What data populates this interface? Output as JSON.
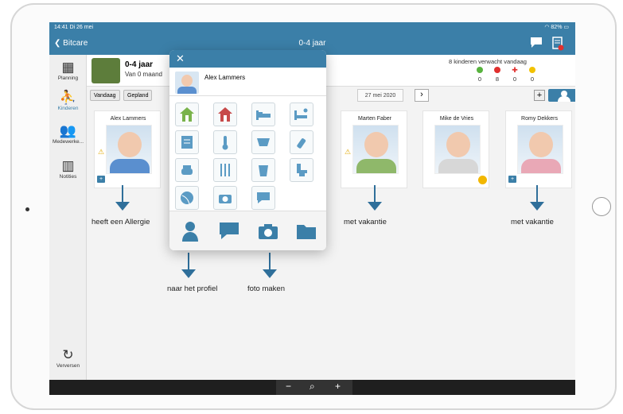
{
  "status": {
    "time": "14:41",
    "date": "Di 26 mei",
    "battery": "82%"
  },
  "nav": {
    "back_label": "Bitcare",
    "title": "0-4 jaar"
  },
  "sidebar": {
    "items": [
      {
        "label": "Planning",
        "icon": "calendar-icon"
      },
      {
        "label": "Kinderen",
        "icon": "children-icon"
      },
      {
        "label": "Medewerke...",
        "icon": "staff-icon"
      },
      {
        "label": "Notities",
        "icon": "notes-icon"
      },
      {
        "label": "Verversen",
        "icon": "refresh-icon"
      }
    ]
  },
  "group": {
    "title": "0-4 jaar",
    "subtitle": "Van 0 maand",
    "expected_text": "8 kinderen verwacht vandaag",
    "counts": [
      {
        "color": "#58b33e",
        "value": "0"
      },
      {
        "color": "#e0302e",
        "value": "8"
      },
      {
        "color": "#e0302e",
        "value": "0"
      },
      {
        "color": "#f2c200",
        "value": "0"
      }
    ]
  },
  "filters": {
    "today": "Vandaag",
    "planned": "Gepland",
    "date": "27 mei 2020",
    "next": "›",
    "add": "+"
  },
  "children": [
    {
      "name": "Alex Lammers",
      "icon": "allergy-warning-icon"
    },
    {
      "name": "Marten Faber",
      "icon": "allergy-warning-icon"
    },
    {
      "name": "Mike de Vries",
      "icon": "vacation-icon"
    },
    {
      "name": "Romy Dekkers",
      "icon": "medical-icon"
    }
  ],
  "popup": {
    "child_name": "Alex Lammers",
    "close_label": "✕"
  },
  "annotations": {
    "allergy": "heeft een Allergie",
    "vacation1": "met vakantie",
    "vacation2": "met vakantie",
    "profile": "naar het profiel",
    "photo": "foto maken"
  },
  "zoom": {
    "minus": "−",
    "zoom": "⌕",
    "plus": "+"
  },
  "colors": {
    "primary": "#3b7fa8",
    "arrow": "#2f6f9a"
  }
}
